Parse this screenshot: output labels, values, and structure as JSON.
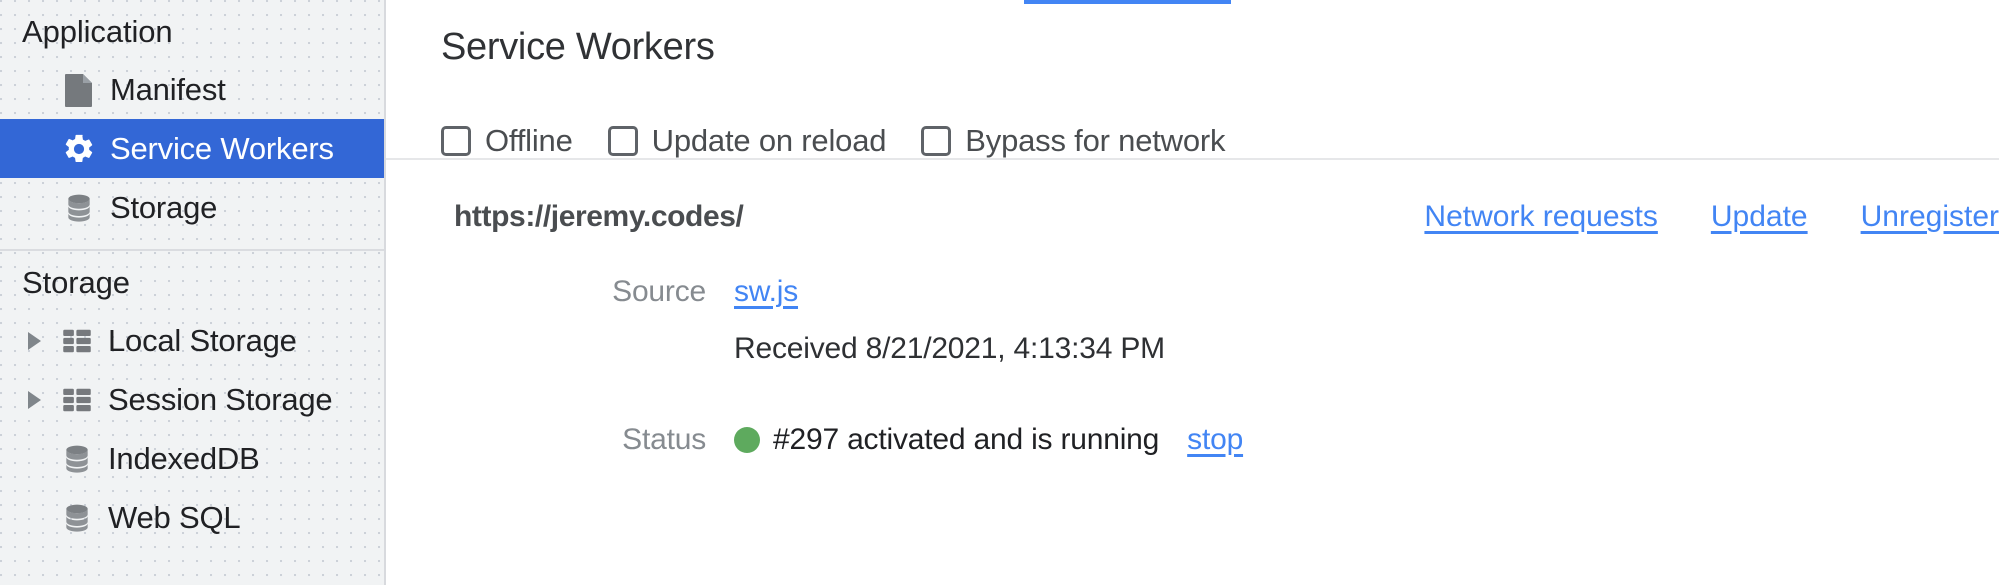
{
  "sidebar": {
    "sections": [
      {
        "title": "Application",
        "items": [
          {
            "label": "Manifest",
            "icon": "document-icon",
            "selected": false,
            "expandable": false
          },
          {
            "label": "Service Workers",
            "icon": "gear-icon",
            "selected": true,
            "expandable": false
          },
          {
            "label": "Storage",
            "icon": "database-icon",
            "selected": false,
            "expandable": false
          }
        ]
      },
      {
        "title": "Storage",
        "items": [
          {
            "label": "Local Storage",
            "icon": "table-icon",
            "selected": false,
            "expandable": true
          },
          {
            "label": "Session Storage",
            "icon": "table-icon",
            "selected": false,
            "expandable": true
          },
          {
            "label": "IndexedDB",
            "icon": "database-icon",
            "selected": false,
            "expandable": false
          },
          {
            "label": "Web SQL",
            "icon": "database-icon",
            "selected": false,
            "expandable": false
          }
        ]
      }
    ]
  },
  "main": {
    "title": "Service Workers",
    "checkboxes": [
      {
        "label": "Offline",
        "checked": false
      },
      {
        "label": "Update on reload",
        "checked": false
      },
      {
        "label": "Bypass for network",
        "checked": false
      }
    ],
    "worker": {
      "origin": "https://jeremy.codes/",
      "actions": [
        {
          "label": "Network requests"
        },
        {
          "label": "Update"
        },
        {
          "label": "Unregister"
        }
      ],
      "source_label": "Source",
      "source_value": "sw.js",
      "received_text": "Received 8/21/2021, 4:13:34 PM",
      "status_label": "Status",
      "status_text": "#297 activated and is running",
      "status_color": "#5eaa5e",
      "stop_label": "stop"
    }
  },
  "colors": {
    "selection": "#3367d6",
    "link": "#4285f4",
    "sidebar_bg": "#f1f3f4"
  }
}
